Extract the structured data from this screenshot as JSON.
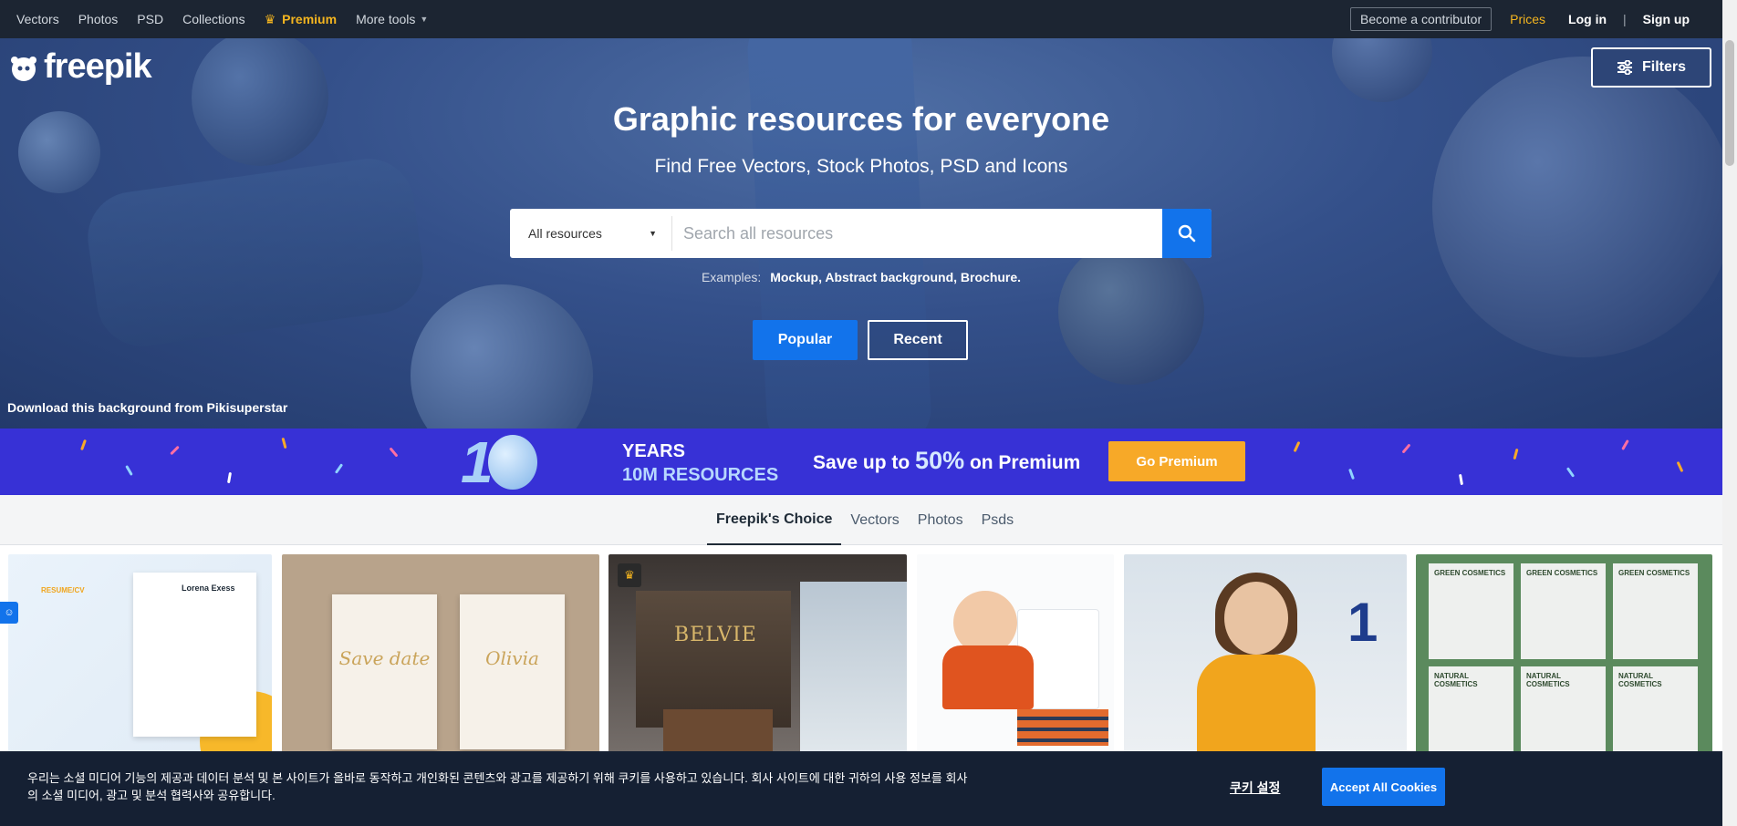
{
  "topnav": {
    "items": [
      "Vectors",
      "Photos",
      "PSD",
      "Collections"
    ],
    "premium": "Premium",
    "more_tools": "More tools",
    "contributor": "Become a contributor",
    "prices": "Prices",
    "login": "Log in",
    "separator": "|",
    "signup": "Sign up"
  },
  "hero": {
    "logo": "freepik",
    "filters": "Filters",
    "title": "Graphic resources for everyone",
    "subtitle": "Find Free Vectors, Stock Photos, PSD and Icons",
    "search": {
      "select_value": "All resources",
      "placeholder": "Search all resources"
    },
    "examples_label": "Examples:",
    "examples": "Mockup, Abstract background, Brochure.",
    "popular": "Popular",
    "recent": "Recent",
    "credit": "Download this background from Pikisuperstar"
  },
  "banner": {
    "ten": "1",
    "years": "YEARS",
    "resources": "10M RESOURCES",
    "save_prefix": "Save up to",
    "save_pct": "50%",
    "save_suffix": "on Premium",
    "cta": "Go Premium"
  },
  "tabs": [
    "Freepik's Choice",
    "Vectors",
    "Photos",
    "Psds"
  ],
  "gallery": {
    "cv_label": "RESUME/CV",
    "cv_name": "Lorena Exess",
    "inv_1": "Save date",
    "inv_2": "Olivia",
    "belvie": "BELVIE",
    "teacher_num": "1",
    "cosmetics": [
      "GREEN COSMETICS",
      "GREEN COSMETICS",
      "GREEN COSMETICS",
      "NATURAL COSMETICS",
      "NATURAL COSMETICS",
      "NATURAL COSMETICS"
    ]
  },
  "cookie": {
    "text": "우리는 소셜 미디어 기능의 제공과 데이터 분석 및 본 사이트가 올바로 동작하고 개인화된 콘텐츠와 광고를 제공하기 위해 쿠키를 사용하고 있습니다. 회사 사이트에 대한 귀하의 사용 정보를 회사의 소셜 미디어, 광고 및 분석 협력사와 공유합니다.",
    "settings": "쿠키 설정",
    "accept": "Accept All Cookies"
  },
  "colors": {
    "topbar": "#1c2532",
    "accent_blue": "#1273eb",
    "premium_gold": "#f4b51f",
    "banner": "#3731d6",
    "cta_orange": "#f7a928"
  },
  "icons": [
    "crown-icon",
    "chevron-down-icon",
    "filters-icon",
    "search-icon",
    "freepik-logo-icon",
    "user-icon"
  ]
}
